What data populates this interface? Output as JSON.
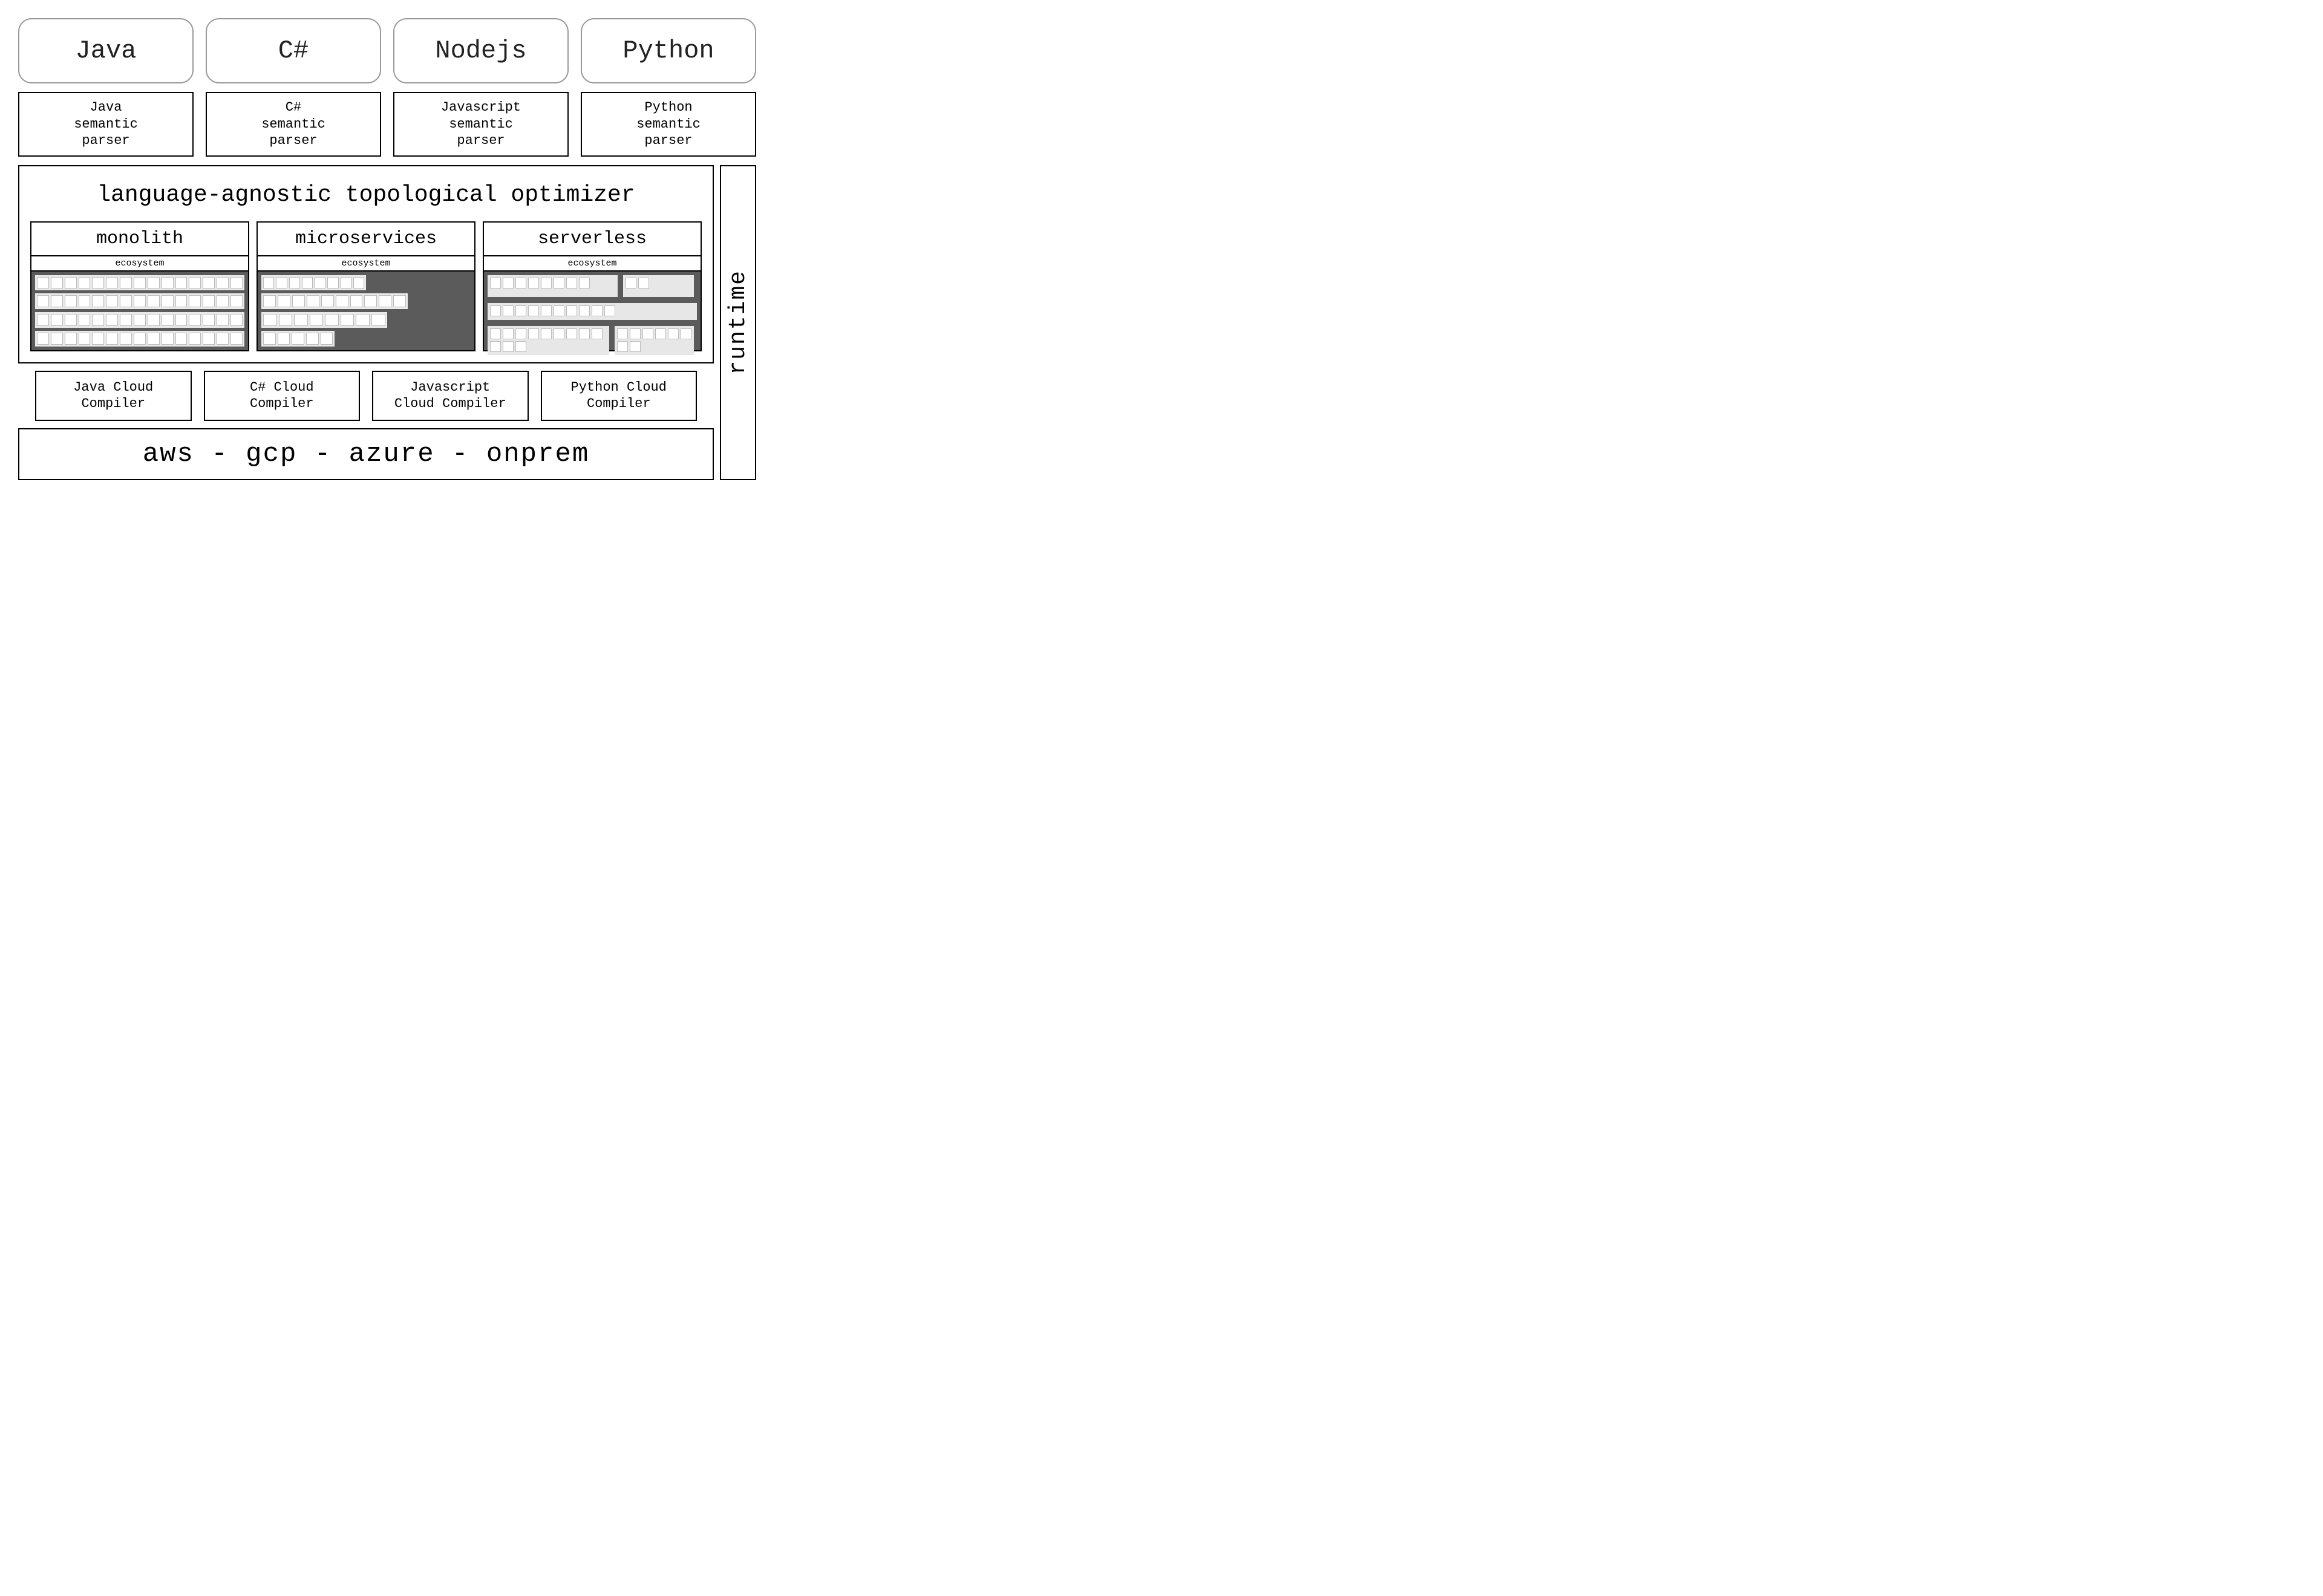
{
  "languages": [
    {
      "label": "Java"
    },
    {
      "label": "C#"
    },
    {
      "label": "Nodejs"
    },
    {
      "label": "Python"
    }
  ],
  "parsers": [
    {
      "label": "Java\nsemantic\nparser"
    },
    {
      "label": "C#\nsemantic\nparser"
    },
    {
      "label": "Javascript\nsemantic\nparser"
    },
    {
      "label": "Python\nsemantic\nparser"
    }
  ],
  "optimizer": {
    "title": "language-agnostic topological optimizer",
    "architectures": [
      {
        "name": "monolith",
        "ecosystem_label": "ecosystem"
      },
      {
        "name": "microservices",
        "ecosystem_label": "ecosystem"
      },
      {
        "name": "serverless",
        "ecosystem_label": "ecosystem"
      }
    ]
  },
  "compilers": [
    {
      "label": "Java Cloud\nCompiler"
    },
    {
      "label": "C# Cloud\nCompiler"
    },
    {
      "label": "Javascript\nCloud Compiler"
    },
    {
      "label": "Python Cloud\nCompiler"
    }
  ],
  "cloud_targets": "aws - gcp - azure - onprem",
  "runtime_label": "runtime"
}
